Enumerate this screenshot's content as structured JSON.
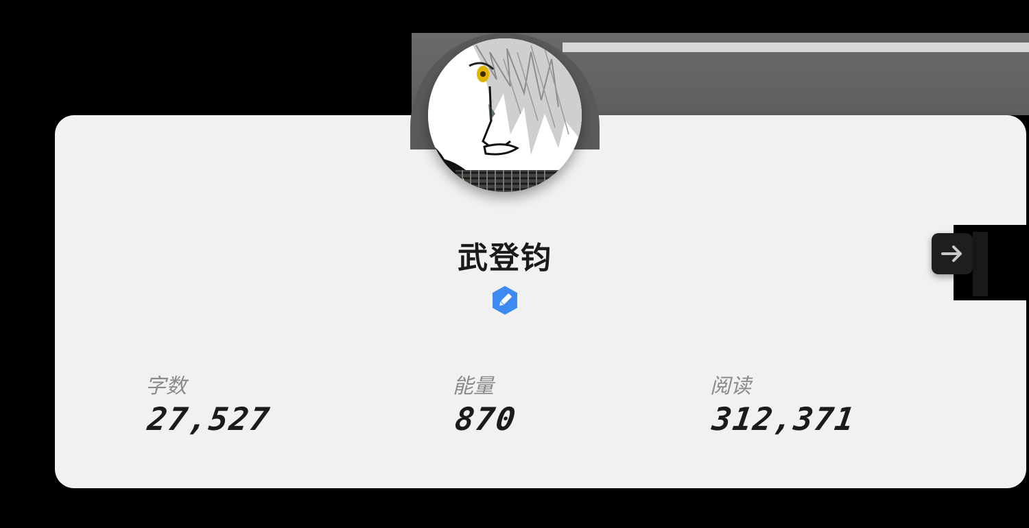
{
  "profile": {
    "name": "武登钧",
    "avatar_icon": "manga-character-avatar",
    "edit_icon": "pencil-icon"
  },
  "stats": [
    {
      "label": "字数",
      "value": "27,527"
    },
    {
      "label": "能量",
      "value": "870"
    },
    {
      "label": "阅读",
      "value": "312,371"
    }
  ],
  "navigation": {
    "next_icon": "arrow-right-icon"
  },
  "colors": {
    "card_background": "#f1f1f1",
    "accent_blue": "#3d8bf2",
    "text_primary": "#1b1b1b",
    "text_label": "#8a8a8a",
    "dark_button": "#1e1e1e"
  }
}
